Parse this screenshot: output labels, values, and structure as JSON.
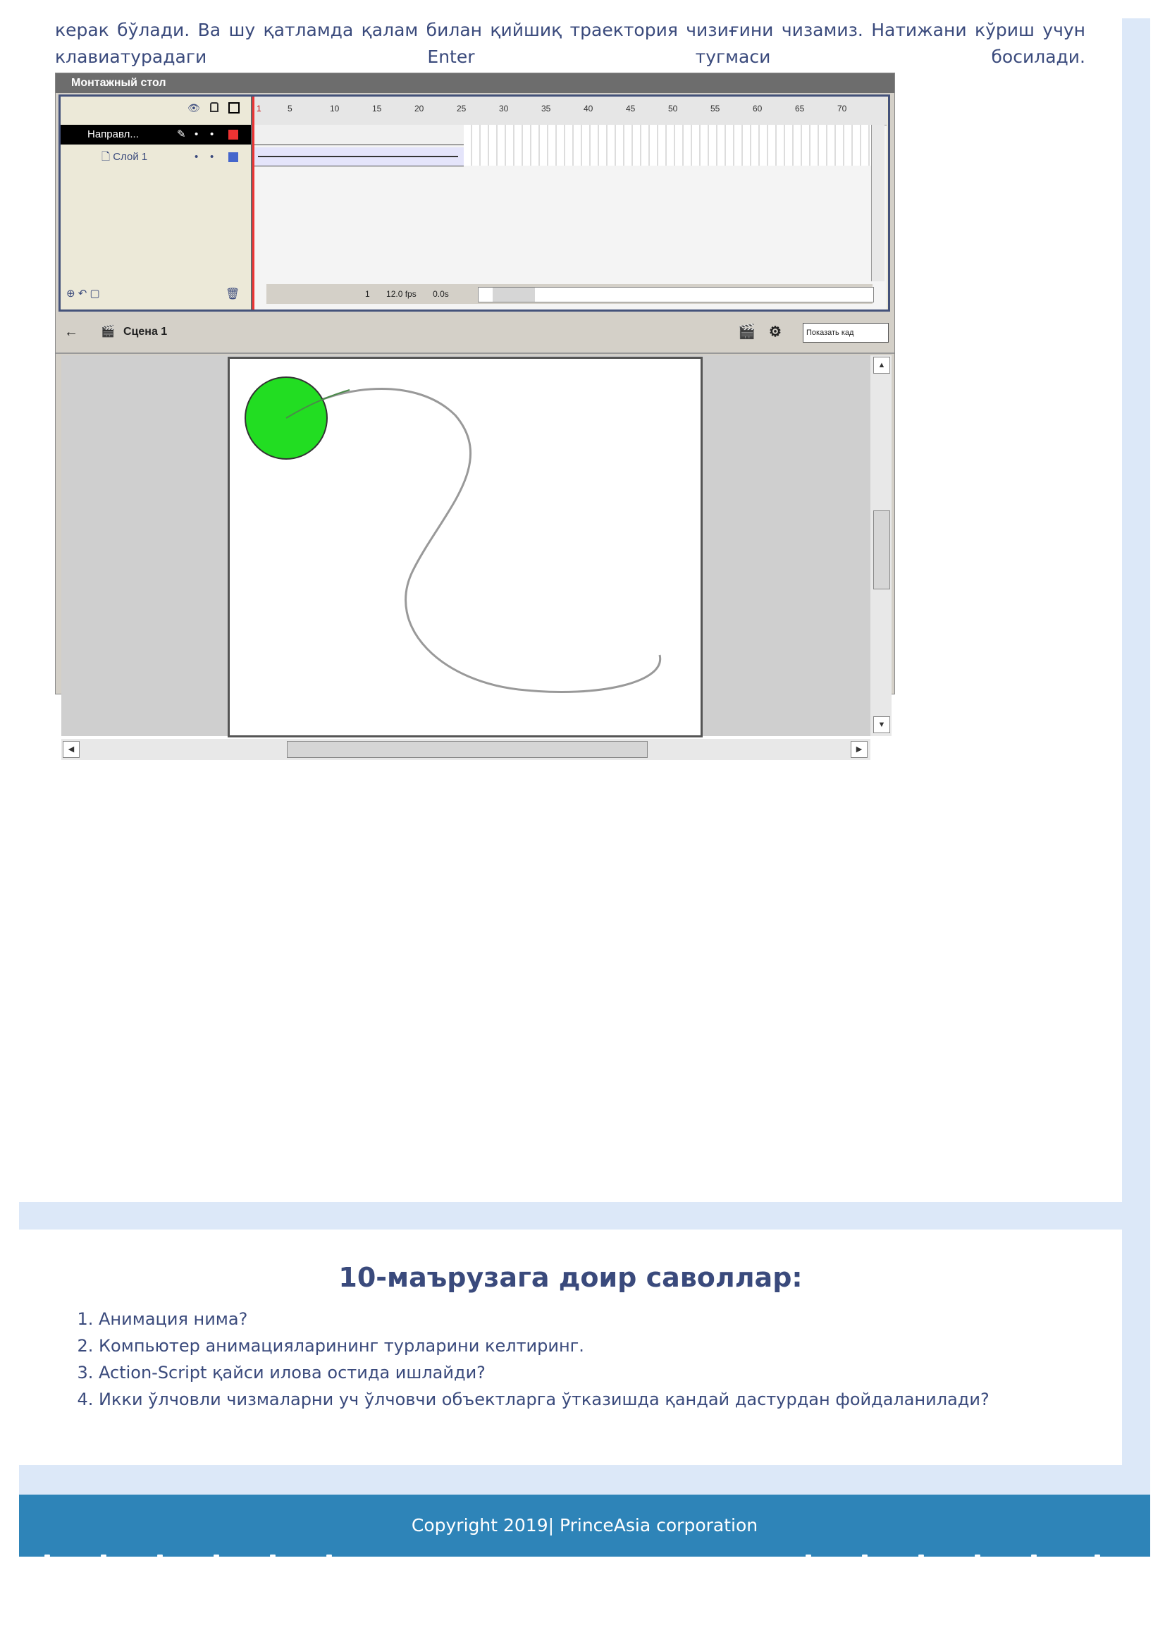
{
  "intro_text": "керак бўлади. Ва шу қатламда қалам билан қийшиқ траектория чизиғини чизамиз. Натижани кўриш учун клавиатурадаги Enter тугмаси босилади.",
  "flash_ui": {
    "timeline_title": "Монтажный стол",
    "layers": [
      "Направл...",
      "Слой 1"
    ],
    "ruler_ticks": [
      "1",
      "5",
      "10",
      "15",
      "20",
      "25",
      "30",
      "35",
      "40",
      "45",
      "50",
      "55",
      "60",
      "65",
      "70"
    ],
    "status": {
      "frame": "1",
      "fps": "12.0 fps",
      "time": "0.0s"
    },
    "scene_label": "Сцена 1",
    "zoom_select": "Показать кад"
  },
  "questions": {
    "title": "10-маърузага доир саволлар:",
    "items": [
      "Анимация нима?",
      "Компьютер анимацияларининг турларини келтиринг.",
      "Action-Script қайси илова остида ишлайди?",
      "Икки ўлчовли чизмаларни уч ўлчовчи объектларга ўтказишда қандай дастурдан фойдаланилади?"
    ]
  },
  "footer": {
    "text": "Copyright 2019| PrinceAsia corporation"
  },
  "colors": {
    "text": "#3a4a7c",
    "footer_bg": "#2e84b8",
    "band": "#dce8f8",
    "ball": "#22dd22"
  },
  "icons": [
    "eye-icon",
    "lock-icon",
    "outline-icon",
    "pencil-icon",
    "layer-icon",
    "trash-icon",
    "back-arrow-icon",
    "scene-icon"
  ]
}
